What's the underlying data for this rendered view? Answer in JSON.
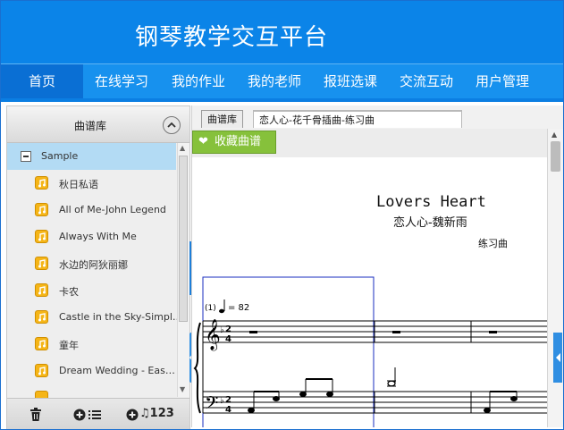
{
  "app": {
    "title": "钢琴教学交互平台"
  },
  "nav": {
    "items": [
      {
        "label": "首页",
        "active": true
      },
      {
        "label": "在线学习"
      },
      {
        "label": "我的作业"
      },
      {
        "label": "我的老师"
      },
      {
        "label": "报班选课"
      },
      {
        "label": "交流互动"
      },
      {
        "label": "用户管理"
      }
    ]
  },
  "library": {
    "title": "曲谱库",
    "folder": "Sample",
    "songs": [
      "秋日私语",
      "All of Me-John Legend",
      "Always With Me",
      "水边的阿狄丽娜",
      "卡农",
      "Castle in the Sky-Simpl…",
      "童年",
      "Dream Wedding - Eas…"
    ],
    "footer": {
      "add_list_icon": "list-icon",
      "add_score_text": "♫123"
    }
  },
  "tabs": [
    {
      "label": "曲谱库"
    },
    {
      "label": "恋人心-花千骨插曲-练习曲",
      "active": true
    }
  ],
  "toolbar": {
    "favorite_label": "收藏曲谱"
  },
  "score": {
    "title": "Lovers Heart",
    "subtitle": "恋人心-魏新雨",
    "kind": "练习曲",
    "measure_number": "(1)",
    "tempo_value": "= 82"
  },
  "colors": {
    "header": "#0b84e8",
    "nav": "#1791ee",
    "accent": "#86c13b",
    "selection": "#b3dbf4"
  }
}
